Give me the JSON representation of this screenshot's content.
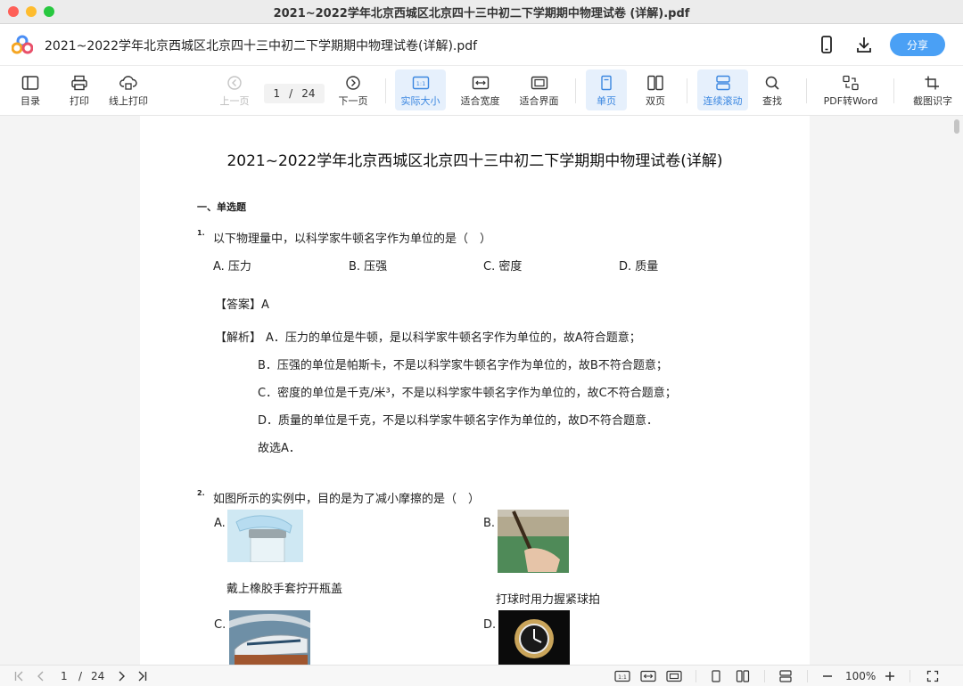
{
  "window": {
    "title": "2021~2022学年北京西城区北京四十三中初二下学期期中物理试卷 (详解).pdf",
    "traffic_colors": [
      "#fe5f57",
      "#febc2e",
      "#28c840"
    ]
  },
  "header": {
    "doc_title": "2021~2022学年北京西城区北京四十三中初二下学期期中物理试卷(详解).pdf",
    "share_label": "分享",
    "icons": [
      "app-logo-icon",
      "mobile-phone-icon",
      "download-icon"
    ],
    "accent_color": "#4aa0f5"
  },
  "toolbar": {
    "contents": "目录",
    "print": "打印",
    "online_print": "线上打印",
    "prev_page": "上一页",
    "current_page": "1",
    "page_sep": "/",
    "total_pages": "24",
    "next_page": "下一页",
    "actual_size": "实际大小",
    "actual_size_badge": "1:1",
    "fit_width": "适合宽度",
    "fit_page": "适合界面",
    "single_page": "单页",
    "double_page": "双页",
    "continuous_scroll": "连续滚动",
    "find": "查找",
    "pdf_to_word": "PDF转Word",
    "screenshot_ocr": "截图识字"
  },
  "document": {
    "title": "2021~2022学年北京西城区北京四十三中初二下学期期中物理试卷(详解)",
    "section_heading": "一、单选题",
    "q1": {
      "number": "1.",
      "text": "以下物理量中，以科学家牛顿名字作为单位的是（　）",
      "options": [
        "A. 压力",
        "B. 压强",
        "C. 密度",
        "D. 质量"
      ],
      "answer": "【答案】A",
      "analysis_head": "【解析】",
      "analysis_lines": [
        "A．压力的单位是牛顿，是以科学家牛顿名字作为单位的，故A符合题意；",
        "B．压强的单位是帕斯卡，不是以科学家牛顿名字作为单位的，故B不符合题意；",
        "C．密度的单位是千克/米³，不是以科学家牛顿名字作为单位的，故C不符合题意；",
        "D．质量的单位是千克，不是以科学家牛顿名字作为单位的，故D不符合题意．",
        "故选A．"
      ]
    },
    "q2": {
      "number": "2.",
      "text": "如图所示的实例中，目的是为了减小摩擦的是（　）",
      "options": [
        {
          "letter": "A.",
          "caption": "戴上橡胶手套拧开瓶盖"
        },
        {
          "letter": "B.",
          "caption": "打球时用力握紧球拍"
        },
        {
          "letter": "C.",
          "caption": ""
        },
        {
          "letter": "D.",
          "caption": ""
        }
      ]
    }
  },
  "statusbar": {
    "current_page": "1",
    "page_sep": "/",
    "total_pages": "24",
    "zoom": "100%",
    "actual_size_badge": "1:1"
  }
}
